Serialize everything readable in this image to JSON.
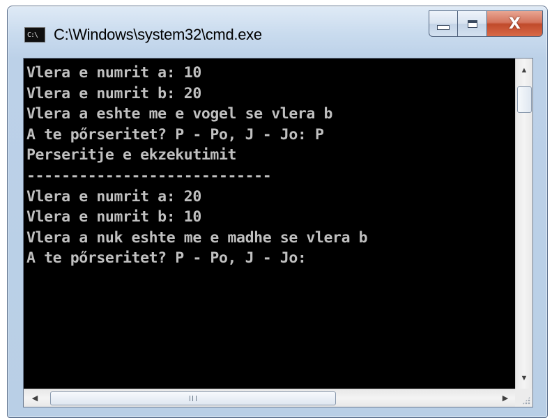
{
  "window": {
    "title": "C:\\Windows\\system32\\cmd.exe",
    "app_icon_text": "C:\\"
  },
  "caption_buttons": {
    "minimize_icon": "minimize-icon",
    "maximize_icon": "maximize-icon",
    "close_glyph": "X"
  },
  "console": {
    "lines": [
      "Vlera e numrit a: 10",
      "Vlera e numrit b: 20",
      "Vlera a eshte me e vogel se vlera b",
      "A te pőrseritet? P - Po, J - Jo: P",
      "Perseritje e ekzekutimit",
      "----------------------------",
      "Vlera e numrit a: 20",
      "Vlera e numrit b: 10",
      "Vlera a nuk eshte me e madhe se vlera b",
      "A te pőrseritet? P - Po, J - Jo:"
    ]
  },
  "scrollbars": {
    "up_arrow": "▲",
    "down_arrow": "▼",
    "left_arrow": "◀",
    "right_arrow": "▶"
  },
  "colors": {
    "console_background": "#000000",
    "console_text": "#c0c0c0",
    "close_button": "#c8492b"
  }
}
